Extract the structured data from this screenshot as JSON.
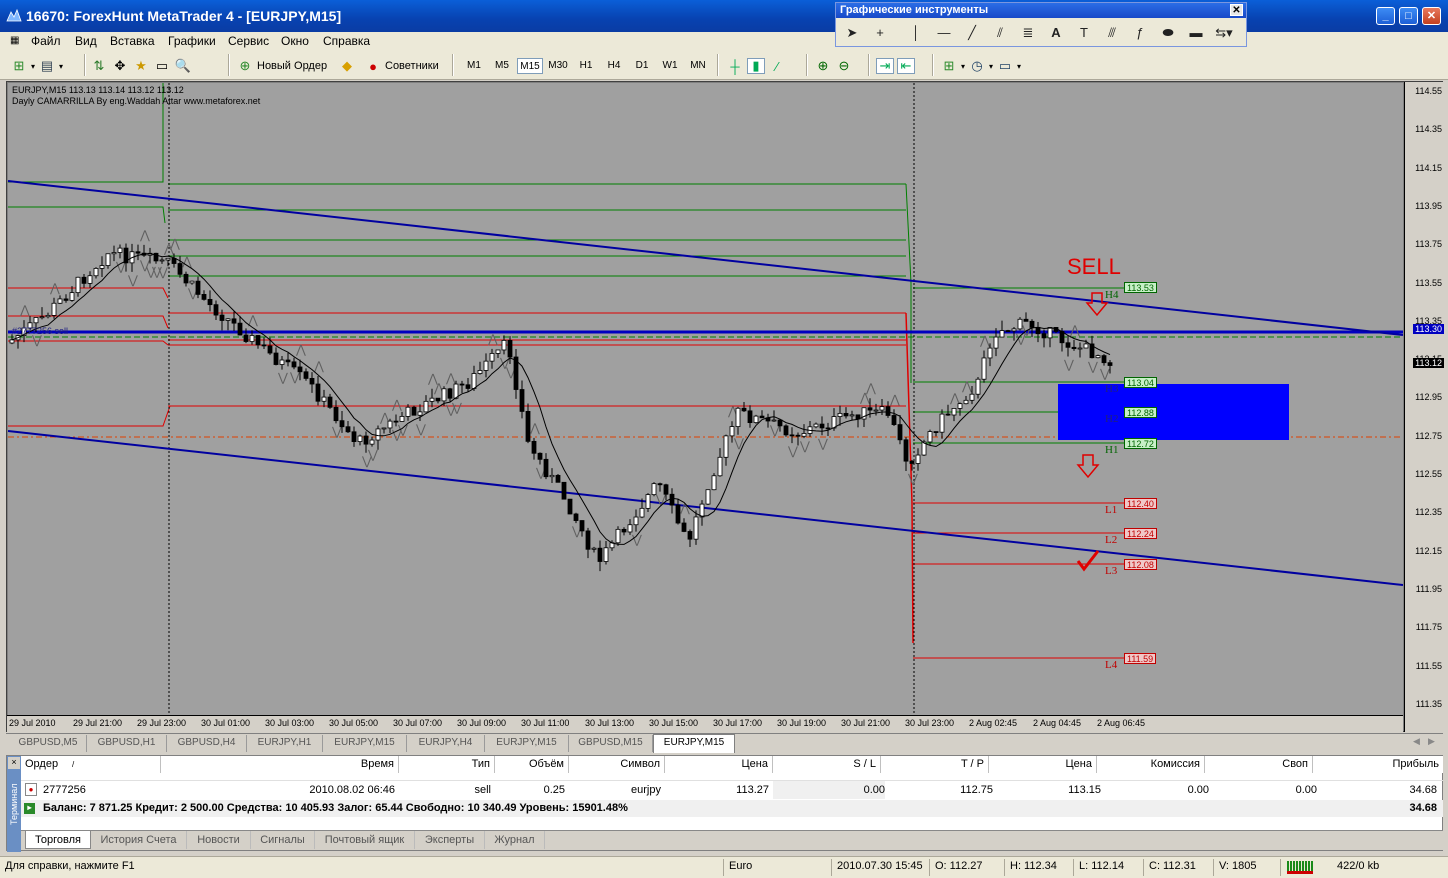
{
  "window": {
    "title": "16670: ForexHunt MetaTrader 4 - [EURJPY,M15]"
  },
  "menu": [
    "Файл",
    "Вид",
    "Вставка",
    "Графики",
    "Сервис",
    "Окно",
    "Справка"
  ],
  "toolbar": {
    "new_order": "Новый Ордер",
    "advisors": "Советники",
    "timeframes": [
      "M1",
      "M5",
      "M15",
      "M30",
      "H1",
      "H4",
      "D1",
      "W1",
      "MN"
    ],
    "active_timeframe": "M15"
  },
  "graphics_palette": {
    "title": "Графические инструменты",
    "text_tool": "A"
  },
  "chart": {
    "header_line1": "EURJPY,M15  113.13 113.14 113.12 113.12",
    "header_line2": "Dayly CAMARRILLA By eng.Waddah Attar www.metaforex.net",
    "order_line_label": "#2777256 sell",
    "sell_label": "SELL",
    "price_ticks": [
      "114.55",
      "114.35",
      "114.15",
      "113.95",
      "113.75",
      "113.55",
      "113.35",
      "113.15",
      "112.95",
      "112.75",
      "112.55",
      "112.35",
      "112.15",
      "111.95",
      "111.75",
      "111.55",
      "111.35"
    ],
    "current_price_marker": "113.30",
    "last_price_marker": "113.12",
    "time_ticks": [
      "29 Jul 2010",
      "29 Jul 21:00",
      "29 Jul 23:00",
      "30 Jul 01:00",
      "30 Jul 03:00",
      "30 Jul 05:00",
      "30 Jul 07:00",
      "30 Jul 09:00",
      "30 Jul 11:00",
      "30 Jul 13:00",
      "30 Jul 15:00",
      "30 Jul 17:00",
      "30 Jul 19:00",
      "30 Jul 21:00",
      "30 Jul 23:00",
      "2 Aug 02:45",
      "2 Aug 04:45",
      "2 Aug 06:45"
    ],
    "levels": [
      {
        "name": "H4",
        "value": "113.53",
        "kind": "g"
      },
      {
        "name": "H3",
        "value": "113.04",
        "kind": "g"
      },
      {
        "name": "H2",
        "value": "112.88",
        "kind": "g"
      },
      {
        "name": "H1",
        "value": "112.72",
        "kind": "g"
      },
      {
        "name": "L1",
        "value": "112.40",
        "kind": "r"
      },
      {
        "name": "L2",
        "value": "112.24",
        "kind": "r"
      },
      {
        "name": "L3",
        "value": "112.08",
        "kind": "r"
      },
      {
        "name": "L4",
        "value": "111.59",
        "kind": "r"
      }
    ],
    "colors": {
      "bg": "#a0a0a0",
      "channel": "#0000a0",
      "resistance": "#008000",
      "support": "#e00000",
      "box": "#0000ff"
    }
  },
  "chart_tabs": [
    "GBPUSD,M5",
    "GBPUSD,H1",
    "GBPUSD,H4",
    "EURJPY,H1",
    "EURJPY,M15",
    "EURJPY,H4",
    "EURJPY,M15",
    "GBPUSD,M15",
    "EURJPY,M15"
  ],
  "active_chart_tab": "EURJPY,M15",
  "terminal": {
    "side_label": "Терминал",
    "columns": [
      "Ордер",
      "Время",
      "Тип",
      "Объём",
      "Символ",
      "Цена",
      "S / L",
      "T / P",
      "Цена",
      "Комиссия",
      "Своп",
      "Прибыль"
    ],
    "order": {
      "id": "2777256",
      "time": "2010.08.02 06:46",
      "type": "sell",
      "volume": "0.25",
      "symbol": "eurjpy",
      "price": "113.27",
      "sl": "0.00",
      "tp": "112.75",
      "current": "113.15",
      "commission": "0.00",
      "swap": "0.00",
      "profit": "34.68"
    },
    "balance_line": "Баланс: 7 871.25  Кредит: 2 500.00  Средства: 10 405.93  Залог: 65.44  Свободно: 10 340.49  Уровень: 15901.48%",
    "balance_profit": "34.68",
    "tabs": [
      "Торговля",
      "История Счета",
      "Новости",
      "Сигналы",
      "Почтовый ящик",
      "Эксперты",
      "Журнал"
    ]
  },
  "status": {
    "help": "Для справки, нажмите F1",
    "profile": "Euro",
    "datetime": "2010.07.30 15:45",
    "open": "O: 112.27",
    "high": "H: 112.34",
    "low": "L: 112.14",
    "close": "C: 112.31",
    "volume": "V: 1805",
    "traffic": "422/0 kb"
  }
}
